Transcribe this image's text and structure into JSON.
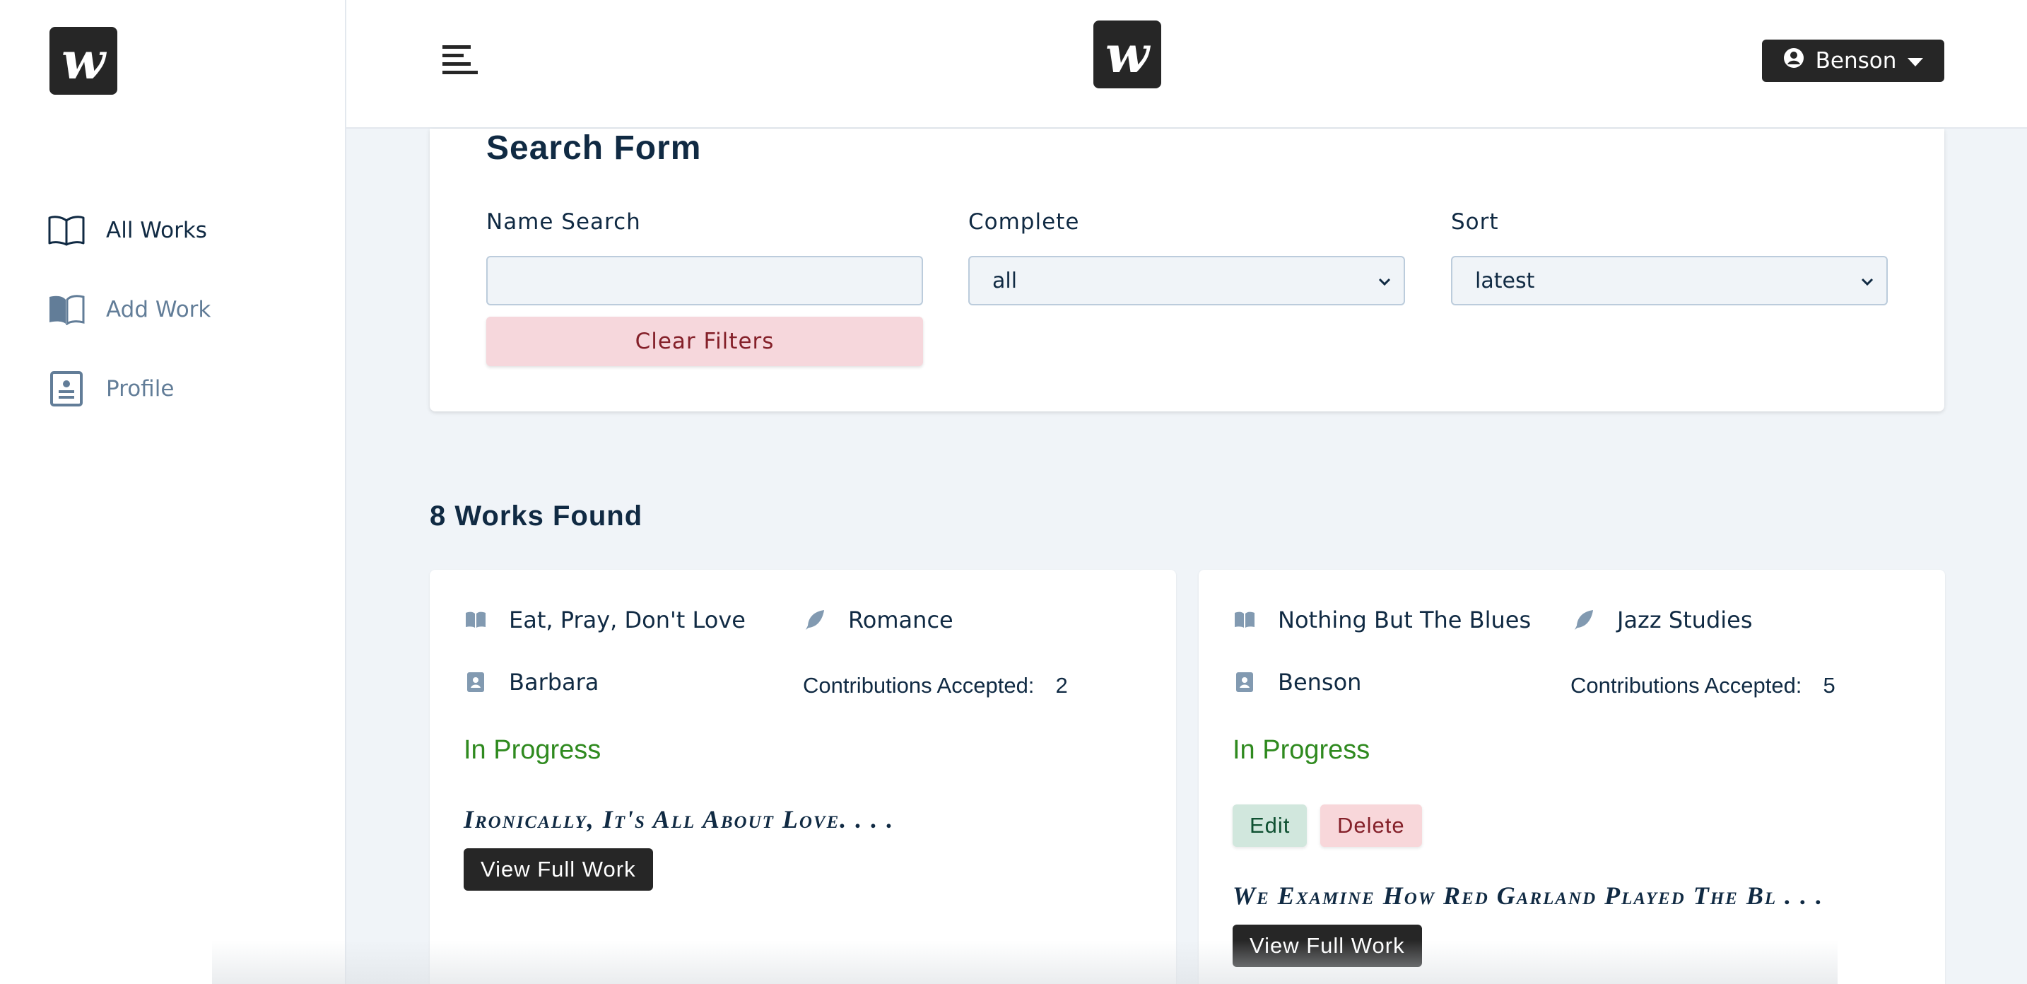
{
  "brand": {
    "logo_letter": "w"
  },
  "sidebar": {
    "items": [
      {
        "label": "All Works",
        "icon": "open-book-icon",
        "active": true
      },
      {
        "label": "Add Work",
        "icon": "book-filled-icon",
        "active": false
      },
      {
        "label": "Profile",
        "icon": "profile-card-icon",
        "active": false
      }
    ]
  },
  "topbar": {
    "user_name": "Benson"
  },
  "search_form": {
    "title": "Search Form",
    "name_label": "Name Search",
    "name_value": "",
    "complete_label": "Complete",
    "complete_value": "all",
    "sort_label": "Sort",
    "sort_value": "latest",
    "clear_label": "Clear Filters"
  },
  "results": {
    "found_text": "8 Works Found"
  },
  "works": [
    {
      "title": "Eat, Pray, Don't Love",
      "genre": "Romance",
      "author": "Barbara",
      "contrib_label": "Contributions Accepted:",
      "contrib_count": "2",
      "status": "In Progress",
      "excerpt": "Ironically, It's All About Love. . . .",
      "view_label": "View Full Work"
    },
    {
      "title": "Nothing But The Blues",
      "genre": "Jazz Studies",
      "author": "Benson",
      "contrib_label": "Contributions Accepted:",
      "contrib_count": "5",
      "status": "In Progress",
      "edit_label": "Edit",
      "delete_label": "Delete",
      "excerpt": "We Examine How Red Garland Played The Bl . . .",
      "view_label": "View Full Work"
    }
  ],
  "colors": {
    "accent_dark": "#262626",
    "status_green": "#2f8a1f",
    "danger_bg": "#f6d7dc",
    "bg": "#f0f4f8"
  }
}
